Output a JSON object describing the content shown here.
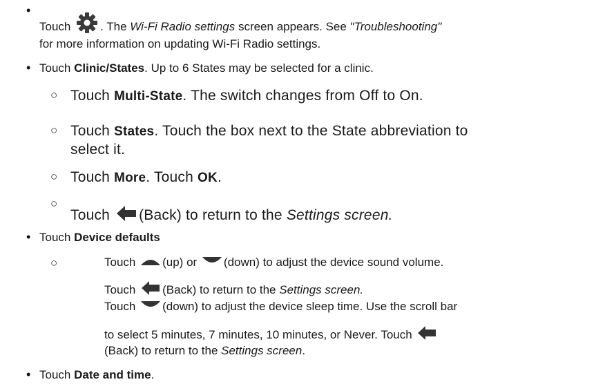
{
  "instructions": {
    "item_wifi": {
      "touch": "Touch",
      "gear_icon": "gear-icon",
      "after_icon": ". The ",
      "screen_name": "Wi-Fi Radio settings",
      "mid": " screen appears. See ",
      "ref": "\"Troubleshooting\"",
      "line2": "for more information on updating Wi-Fi Radio settings."
    },
    "item_clinic": {
      "touch": "Touch ",
      "label": "Clinic/States",
      "rest": ". Up to 6 States may be selected for a clinic."
    },
    "sub_multistate": {
      "touch": "Touch ",
      "label": "Multi-State",
      "rest": ". The switch changes from Off to On."
    },
    "sub_states": {
      "touch": "Touch ",
      "label": "States",
      "rest": ". Touch the box next to the State abbreviation to",
      "line2": "select it."
    },
    "sub_more": {
      "touch": "Touch ",
      "label": "More",
      "mid": ". Touch ",
      "label2": "OK",
      "end": "."
    },
    "sub_back": {
      "touch": "Touch",
      "back_icon": "back-arrow-icon",
      "rest": "(Back) to return to the ",
      "screen": "Settings screen."
    },
    "item_device": {
      "touch": "Touch ",
      "label": "Device defaults"
    },
    "device_volume": {
      "touch": "Touch",
      "up_icon": "up-triangle-icon",
      "up_text": "(up) or",
      "down_icon": "down-triangle-icon",
      "rest": "(down) to adjust the device sound volume."
    },
    "device_back": {
      "touch": "Touch",
      "back_icon": "back-arrow-icon",
      "rest": "(Back) to return to the ",
      "screen": "Settings screen."
    },
    "device_sleep": {
      "touch": "Touch",
      "down_icon": "down-triangle-icon",
      "rest": "(down) to adjust the device sleep time. Use the scroll bar",
      "line2a": "to select 5 minutes, 7 minutes, 10 minutes, or Never. Touch",
      "back_icon": "back-arrow-icon",
      "line3a": "(Back) to return to the ",
      "screen": "Settings screen",
      "line3b": "."
    },
    "item_date": {
      "touch": "Touch ",
      "label": "Date and time",
      "end": "."
    },
    "colors": {
      "text": "#1a1a1a",
      "icon": "#333333"
    }
  }
}
